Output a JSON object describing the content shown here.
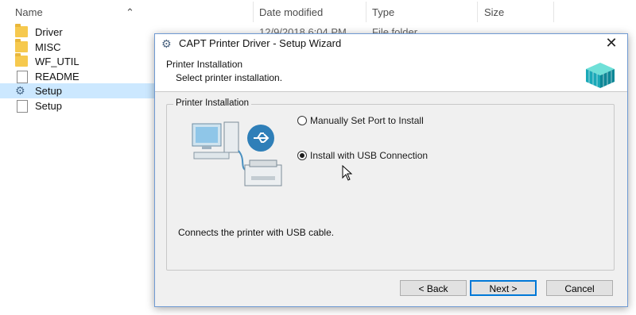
{
  "explorer": {
    "columns": [
      "Name",
      "Date modified",
      "Type",
      "Size"
    ],
    "files": [
      {
        "name": "Driver",
        "icon": "folder-icon"
      },
      {
        "name": "MISC",
        "icon": "folder-icon"
      },
      {
        "name": "WF_UTIL",
        "icon": "folder-icon"
      },
      {
        "name": "README",
        "icon": "document-icon"
      },
      {
        "name": "Setup",
        "icon": "setup-gear-icon",
        "selected": true
      },
      {
        "name": "Setup",
        "icon": "setup-info-icon"
      }
    ],
    "first_row_date": "12/9/2018 6:04 PM",
    "first_row_type": "File folder"
  },
  "dialog": {
    "title": "CAPT Printer Driver - Setup Wizard",
    "close_glyph": "✕",
    "header_title": "Printer Installation",
    "header_subtitle": "Select printer installation.",
    "group_label": "Printer Installation",
    "options": [
      {
        "label": "Manually Set Port to Install",
        "selected": false
      },
      {
        "label": "Install with USB Connection",
        "selected": true
      }
    ],
    "description": "Connects the printer with USB cable.",
    "buttons": {
      "back": "< Back",
      "next": "Next >",
      "cancel": "Cancel"
    }
  },
  "colors": {
    "selection": "#cce8ff",
    "dialog_bg": "#f0f0f0",
    "default_button_border": "#0078d7"
  }
}
